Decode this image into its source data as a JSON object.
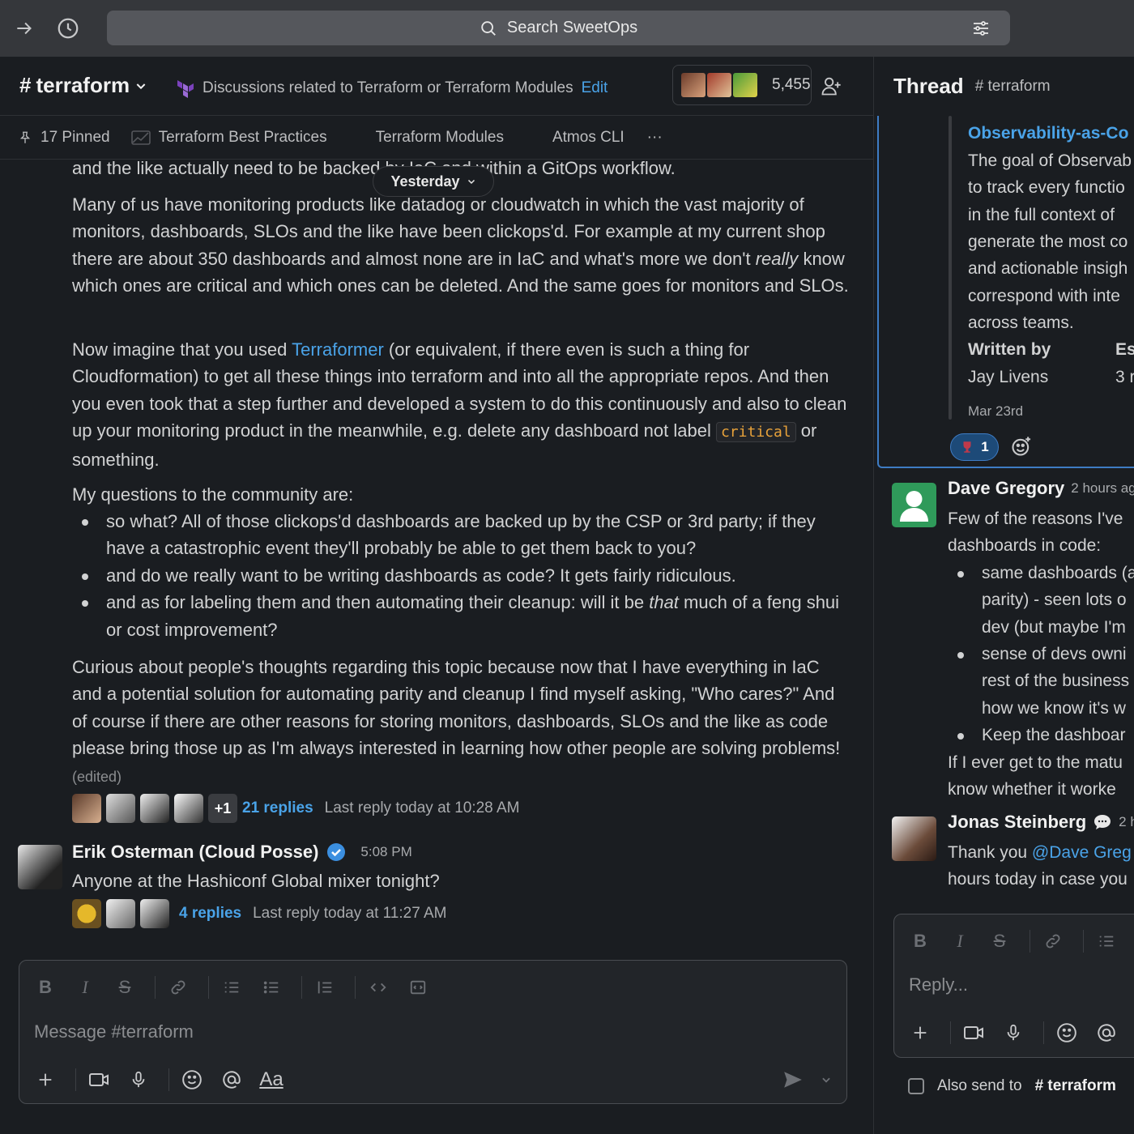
{
  "search": {
    "placeholder": "Search SweetOps"
  },
  "channel": {
    "name": "terraform",
    "topic": "Discussions related to Terraform or Terraform Modules",
    "edit_label": "Edit",
    "member_count": "5,455"
  },
  "tabs": {
    "pinned": "17 Pinned",
    "items": [
      "Terraform Best Practices",
      "Terraform Modules",
      "Atmos CLI"
    ],
    "more": "···"
  },
  "day_divider": "Yesterday",
  "post": {
    "line0": "and the like actually need to be backed by IaC and within a GitOps workflow.",
    "p1": "Many of us have monitoring products like datadog or cloudwatch in which the vast majority of monitors, dashboards, SLOs and the like have been clickops'd. For example at my current shop there are about 350 dashboards and almost none are in IaC and what's more we don't",
    "p1_em": "really",
    "p1_end": "know which ones are critical and which ones can be deleted. And the same goes for monitors and SLOs.",
    "p2_a": "Now imagine that you used",
    "p2_link": "Terraformer",
    "p2_b": "(or equivalent, if there even is such a thing for Cloudformation) to get all these things into terraform and into all the appropriate repos. And then you even took that a step further and developed a system to do this continuously and also to clean up your monitoring product in the meanwhile, e.g. delete any dashboard not label",
    "p2_code": "critical",
    "p2_c": "or something.",
    "p3": "My questions to the community are:",
    "bullet1": "so what? All of those clickops'd dashboards are backed up by the CSP or 3rd party; if they have a catastrophic event they'll probably be able to get them back to you?",
    "bullet2": "and do we really want to be writing dashboards as code? It gets fairly ridiculous.",
    "bullet3_a": "and as for labeling them and then automating their cleanup: will it be",
    "bullet3_em": "that",
    "bullet3_b": "much of a feng shui or cost improvement?",
    "p4": "Curious about people's thoughts regarding this topic because now that I have everything in IaC and a potential solution for automating parity and cleanup I find myself asking, \"Who cares?\" And of course if there are other reasons for storing monitors, dashboards, SLOs and the like as code please bring those up as I'm always interested in learning how other people are solving problems!",
    "edited": "(edited)",
    "replies_more": "+1",
    "replies_count": "21 replies",
    "last_reply": "Last reply today at 10:28 AM"
  },
  "erik": {
    "name": "Erik Osterman (Cloud Posse)",
    "time": "5:08 PM",
    "text": "Anyone at the Hashiconf Global mixer tonight?",
    "replies_count": "4 replies",
    "last_reply": "Last reply today at 11:27 AM"
  },
  "composer": {
    "placeholder": "Message #terraform",
    "format_label": "Aa"
  },
  "thread": {
    "title": "Thread",
    "channel": "# terraform",
    "attachment": {
      "title": "Observability-as-Co",
      "lines": [
        "The goal of Observab",
        "to track every functio",
        "in the full context of",
        "generate the most co",
        "and actionable insigh",
        "correspond with inte",
        "across teams."
      ],
      "written_by_label": "Written by",
      "author": "Jay Livens",
      "est_label": "Es",
      "est_value": "3 r",
      "date": "Mar 23rd"
    },
    "reaction_count": "1",
    "dave": {
      "name": "Dave Gregory",
      "time": "2 hours ag",
      "line1": "Few of the reasons I've",
      "line2": "dashboards in code:",
      "b1": [
        "same dashboards (a",
        "parity) - seen lots o",
        "dev (but maybe I'm"
      ],
      "b2": [
        "sense of devs owni",
        "rest of the business",
        "how we know it's w"
      ],
      "b3": [
        "Keep the dashboar"
      ],
      "line3": "If I ever get to the matu",
      "line4": "know whether it worke"
    },
    "jonas": {
      "name": "Jonas Steinberg",
      "time": "2 h",
      "text_a": "Thank you",
      "mention": "@Dave Greg",
      "line2": "hours today in case you"
    },
    "reply_placeholder": "Reply...",
    "also_send_a": "Also send to",
    "also_send_b": "# terraform"
  },
  "colors": {
    "accent": "#4aa3e8",
    "background": "#1a1d21",
    "topbar": "#35373b",
    "thread_border": "#3e7cc4"
  }
}
